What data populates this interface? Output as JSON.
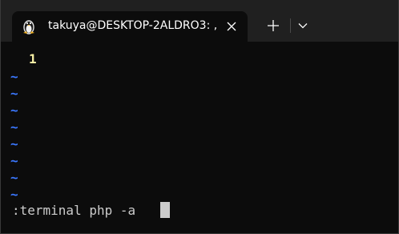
{
  "window": {
    "tab_title": "takuya@DESKTOP-2ALDRO3: ,",
    "tab_icon": "linux-penguin-icon",
    "close_icon": "close-icon",
    "new_tab_icon": "plus-icon",
    "dropdown_icon": "chevron-down-icon"
  },
  "editor": {
    "line_numbers": [
      "1"
    ],
    "empty_line_markers": [
      "~",
      "~",
      "~",
      "~",
      "~",
      "~",
      "~",
      "~"
    ],
    "command_line": ":terminal php -a "
  },
  "colors": {
    "background": "#0c0c0c",
    "titlebar": "#202020",
    "line_number": "#f9f1a5",
    "tilde": "#3b78ff",
    "text": "#cccccc"
  }
}
